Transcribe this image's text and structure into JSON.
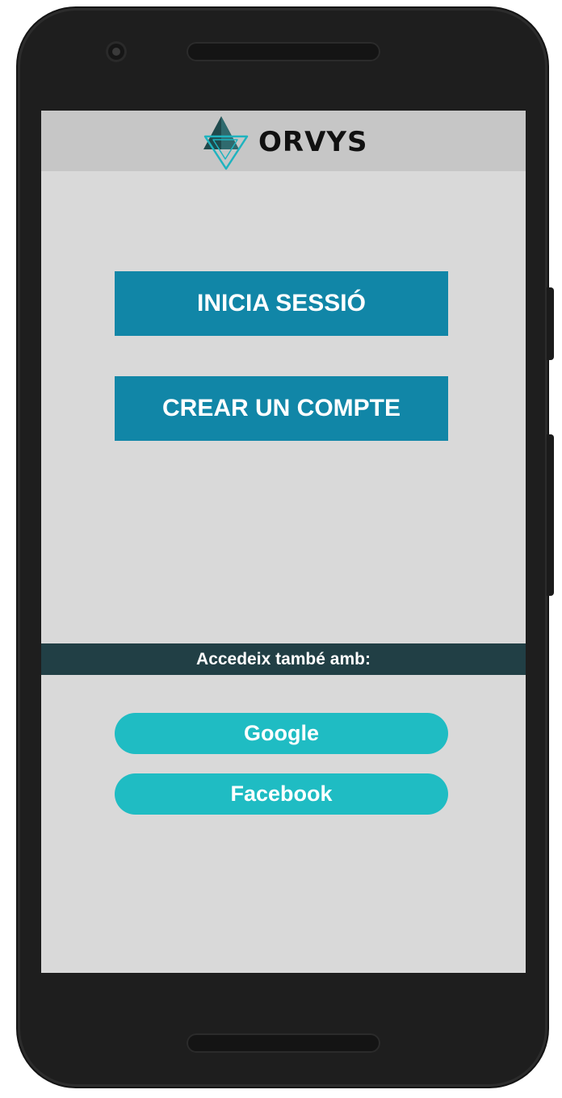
{
  "app": {
    "brand": "ORVYS",
    "logo_icon": "triangle-logo-icon"
  },
  "auth": {
    "login_label": "INICIA SESSIÓ",
    "register_label": "CREAR UN COMPTE"
  },
  "social": {
    "heading": "Accedeix també amb:",
    "google_label": "Google",
    "facebook_label": "Facebook"
  },
  "colors": {
    "primary_button": "#1186a7",
    "social_button": "#1fbcc3",
    "divider_bar": "#213f45",
    "app_bar": "#c6c6c6",
    "screen_background": "#d9d9d9",
    "logo_accent": "#1fb3bf"
  }
}
